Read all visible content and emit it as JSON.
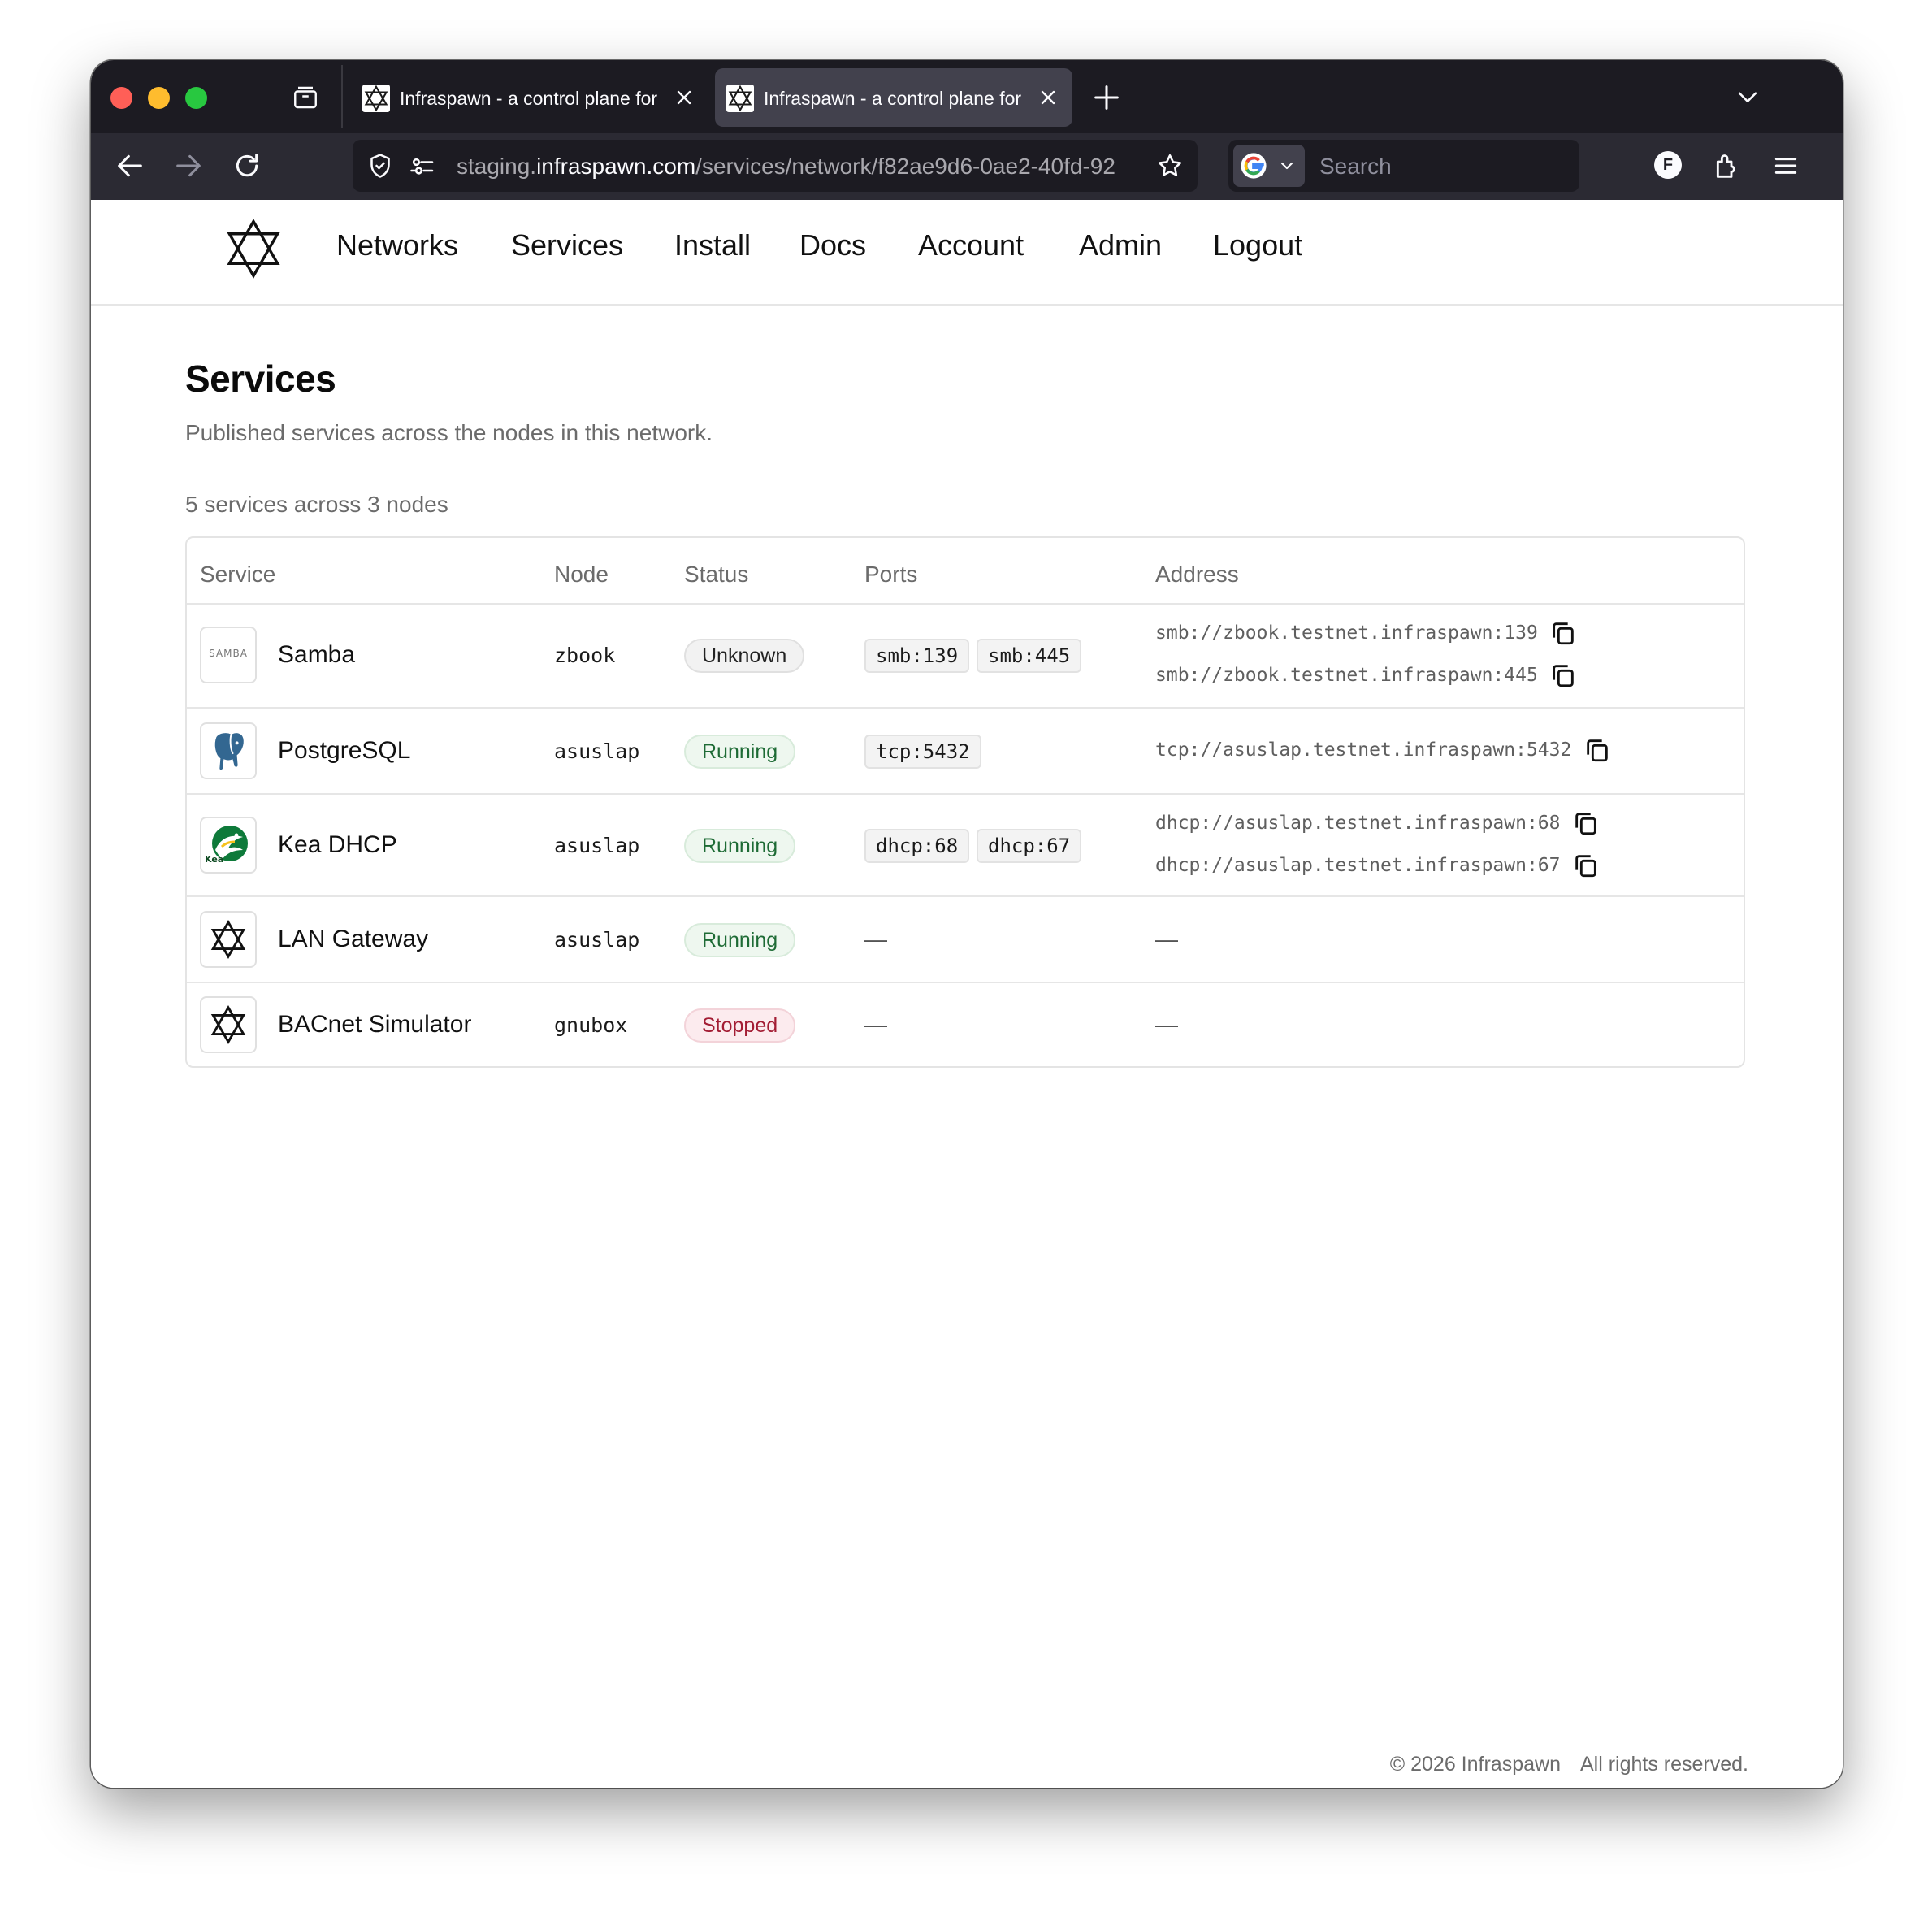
{
  "browser": {
    "tabs": [
      {
        "title": "Infraspawn - a control plane for",
        "active": false
      },
      {
        "title": "Infraspawn - a control plane for",
        "active": true
      }
    ],
    "url_prefix": "staging.",
    "url_host": "infraspawn.com",
    "url_path": "/services/network/f82ae9d6-0ae2-40fd-92",
    "search_placeholder": "Search",
    "account_initial": "F",
    "colors": {
      "tabstrip": "#1c1b22",
      "toolbar": "#2b2a33",
      "active_tab": "#42414d"
    }
  },
  "nav": {
    "logo_icon": "infraspawn-star-icon",
    "links": [
      "Networks",
      "Services",
      "Install",
      "Docs",
      "Account",
      "Admin",
      "Logout"
    ]
  },
  "main": {
    "title": "Services",
    "subtitle": "Published services across the nodes in this network.",
    "summary": "5 services across 3 nodes",
    "table": {
      "columns": [
        "Service",
        "Node",
        "Status",
        "Ports",
        "Address"
      ],
      "rows": [
        {
          "icon": "samba-logo-icon",
          "icon_text": "SAMBA",
          "service": "Samba",
          "node": "zbook",
          "status": "Unknown",
          "ports": [
            "smb:139",
            "smb:445"
          ],
          "addresses": [
            "smb://zbook.testnet.infraspawn:139",
            "smb://zbook.testnet.infraspawn:445"
          ]
        },
        {
          "icon": "postgresql-elephant-icon",
          "service": "PostgreSQL",
          "node": "asuslap",
          "status": "Running",
          "ports": [
            "tcp:5432"
          ],
          "addresses": [
            "tcp://asuslap.testnet.infraspawn:5432"
          ]
        },
        {
          "icon": "kea-bird-icon",
          "icon_text": "Kea",
          "service": "Kea DHCP",
          "node": "asuslap",
          "status": "Running",
          "ports": [
            "dhcp:68",
            "dhcp:67"
          ],
          "addresses": [
            "dhcp://asuslap.testnet.infraspawn:68",
            "dhcp://asuslap.testnet.infraspawn:67"
          ]
        },
        {
          "icon": "infraspawn-star-icon",
          "service": "LAN Gateway",
          "node": "asuslap",
          "status": "Running",
          "ports_empty": "—",
          "address_empty": "—"
        },
        {
          "icon": "infraspawn-star-icon",
          "service": "BACnet Simulator",
          "node": "gnubox",
          "status": "Stopped",
          "ports_empty": "—",
          "address_empty": "—"
        }
      ]
    },
    "status_colors": {
      "Unknown": "#222222",
      "Running": "#1e6b35",
      "Stopped": "#a31d34"
    }
  },
  "footer": {
    "copyright": "© 2026 Infraspawn",
    "rights": "All rights reserved."
  }
}
